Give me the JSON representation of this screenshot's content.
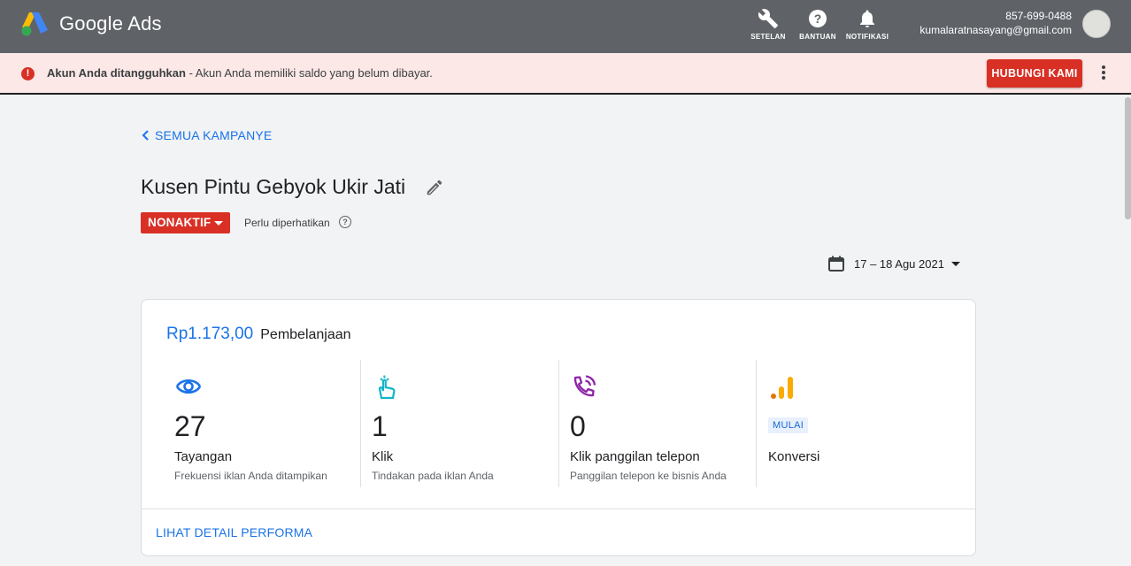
{
  "header": {
    "brand": "Google Ads",
    "tools": [
      {
        "label": "SETELAN",
        "icon": "wrench-icon"
      },
      {
        "label": "BANTUAN",
        "icon": "help-icon"
      },
      {
        "label": "NOTIFIKASI",
        "icon": "bell-icon"
      }
    ],
    "account": {
      "phone": "857-699-0488",
      "email": "kumalaratnasayang@gmail.com"
    }
  },
  "alert": {
    "title": "Akun Anda ditangguhkan",
    "message": " - Akun Anda memiliki saldo yang belum dibayar.",
    "action": "HUBUNGI KAMI"
  },
  "nav": {
    "back_label": "SEMUA KAMPANYE"
  },
  "campaign": {
    "name": "Kusen Pintu Gebyok Ukir Jati",
    "status": "NONAKTIF",
    "status_note": "Perlu diperhatikan"
  },
  "date_range": "17 – 18 Agu 2021",
  "summary": {
    "spend_amount": "Rp1.173,00",
    "spend_label": "Pembelanjaan",
    "metrics": [
      {
        "value": "27",
        "name": "Tayangan",
        "desc": "Frekuensi iklan Anda ditampikan",
        "icon": "eye-icon"
      },
      {
        "value": "1",
        "name": "Klik",
        "desc": "Tindakan pada iklan Anda",
        "icon": "tap-icon"
      },
      {
        "value": "0",
        "name": "Klik panggilan telepon",
        "desc": "Panggilan telepon ke bisnis Anda",
        "icon": "phone-call-icon"
      },
      {
        "badge": "MULAI",
        "name": "Konversi",
        "icon": "bar-chart-icon"
      }
    ],
    "detail_link": "LIHAT DETAIL PERFORMA"
  },
  "colors": {
    "header_bg": "#5f6368",
    "alert_bg": "#fce8e6",
    "danger": "#d93025",
    "link": "#1a73e8",
    "page_bg": "#f1f3f4"
  }
}
